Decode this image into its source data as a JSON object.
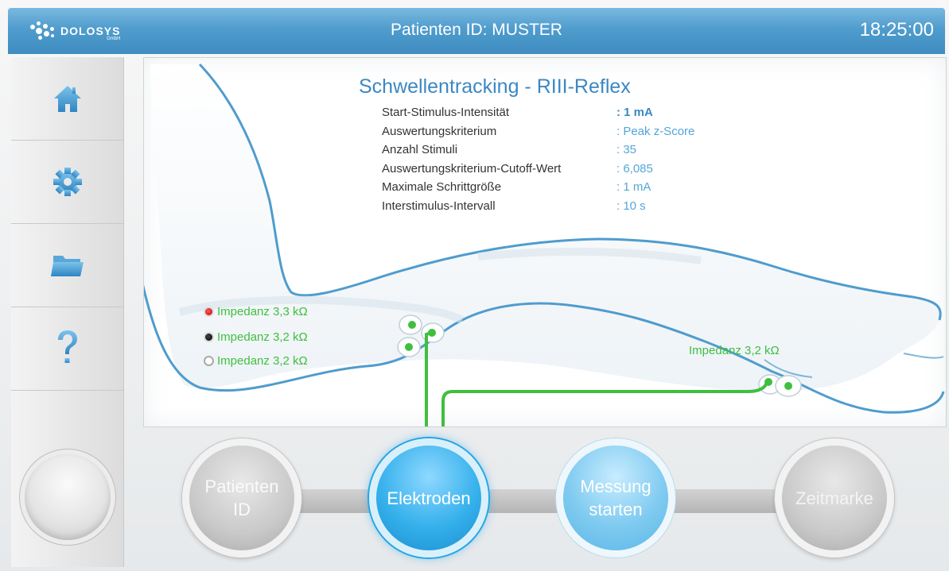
{
  "header": {
    "logo_text": "DOLOSYS",
    "logo_sub": "GmbH",
    "patient_id": "Patienten ID: MUSTER",
    "clock": "18:25:00"
  },
  "sidebar": {
    "items": [
      {
        "icon": "home-icon"
      },
      {
        "icon": "gear-icon"
      },
      {
        "icon": "folder-icon"
      },
      {
        "icon": "help-icon"
      }
    ]
  },
  "params": {
    "title": "Schwellentracking - RIII-Reflex",
    "rows": [
      {
        "label": "Start-Stimulus-Intensität",
        "value": ": 1 mA"
      },
      {
        "label": "Auswertungskriterium",
        "value": ": Peak z-Score"
      },
      {
        "label": "Anzahl Stimuli",
        "value": ": 35"
      },
      {
        "label": "Auswertungskriterium-Cutoff-Wert",
        "value": ": 6,085"
      },
      {
        "label": "Maximale Schrittgröße",
        "value": ": 1 mA"
      },
      {
        "label": "Interstimulus-Intervall",
        "value": ": 10 s"
      }
    ]
  },
  "impedances": {
    "red": "Impedanz 3,3 kΩ",
    "black": "Impedanz 3,2 kΩ",
    "white": "Impedanz 3,2 kΩ",
    "foot": "Impedanz 3,2 kΩ"
  },
  "workflow": {
    "steps": [
      {
        "line1": "Patienten",
        "line2": "ID"
      },
      {
        "line1": "Elektroden"
      },
      {
        "line1": "Messung",
        "line2": "starten"
      },
      {
        "line1": "Zeitmarke"
      }
    ]
  },
  "colors": {
    "header_blue": "#4f9ccd",
    "accent_blue": "#3b88c4",
    "value_blue": "#55a6d8",
    "electrode_green": "#3fbf3f",
    "active_step": "#36b1ec"
  }
}
